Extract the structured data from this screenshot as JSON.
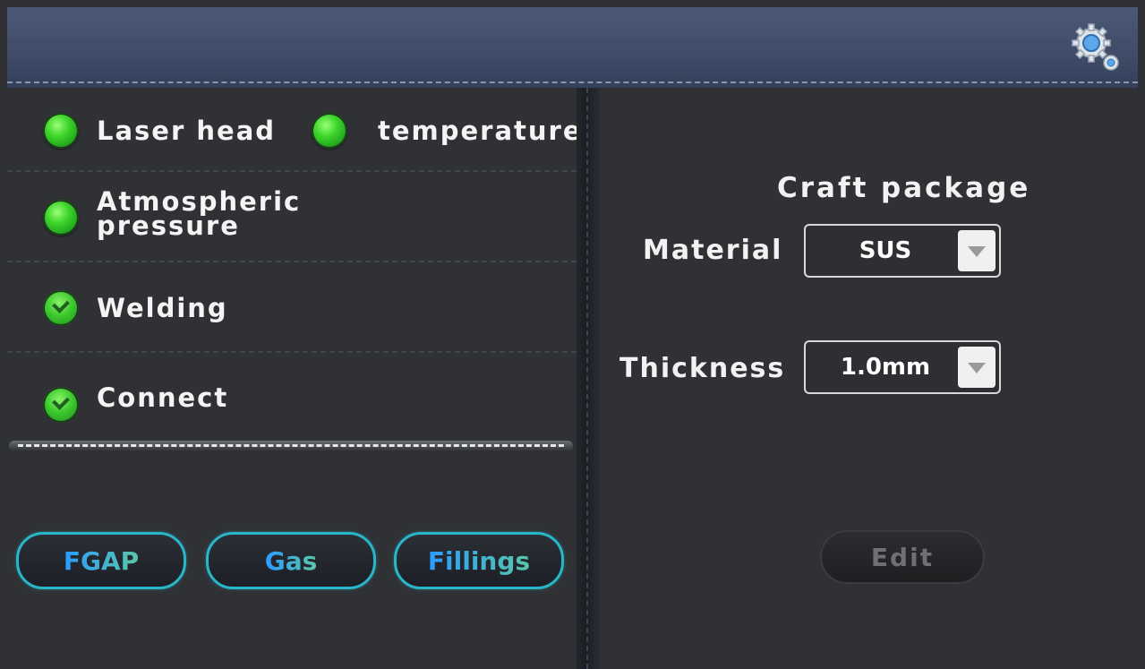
{
  "header": {
    "settings_icon": "gears-icon"
  },
  "status": {
    "laser_head": {
      "label": "Laser head",
      "state": "ok"
    },
    "temperature": {
      "label": "temperature",
      "state": "ok"
    },
    "atmospheric": {
      "label_line1": "Atmospheric",
      "label_line2": "pressure",
      "state": "ok"
    },
    "welding": {
      "label": "Welding",
      "state": "checked"
    },
    "connect": {
      "label": "Connect",
      "state": "checked"
    }
  },
  "buttons": {
    "fgap": "FGAP",
    "gas": "Gas",
    "fillings": "Fillings",
    "edit": "Edit"
  },
  "craft": {
    "title": "Craft package",
    "material_label": "Material",
    "material_value": "SUS",
    "thickness_label": "Thickness",
    "thickness_value": "1.0mm"
  },
  "colors": {
    "accent": "#2ab6c9",
    "led_green": "#3fd62a",
    "header": "#45516f"
  }
}
